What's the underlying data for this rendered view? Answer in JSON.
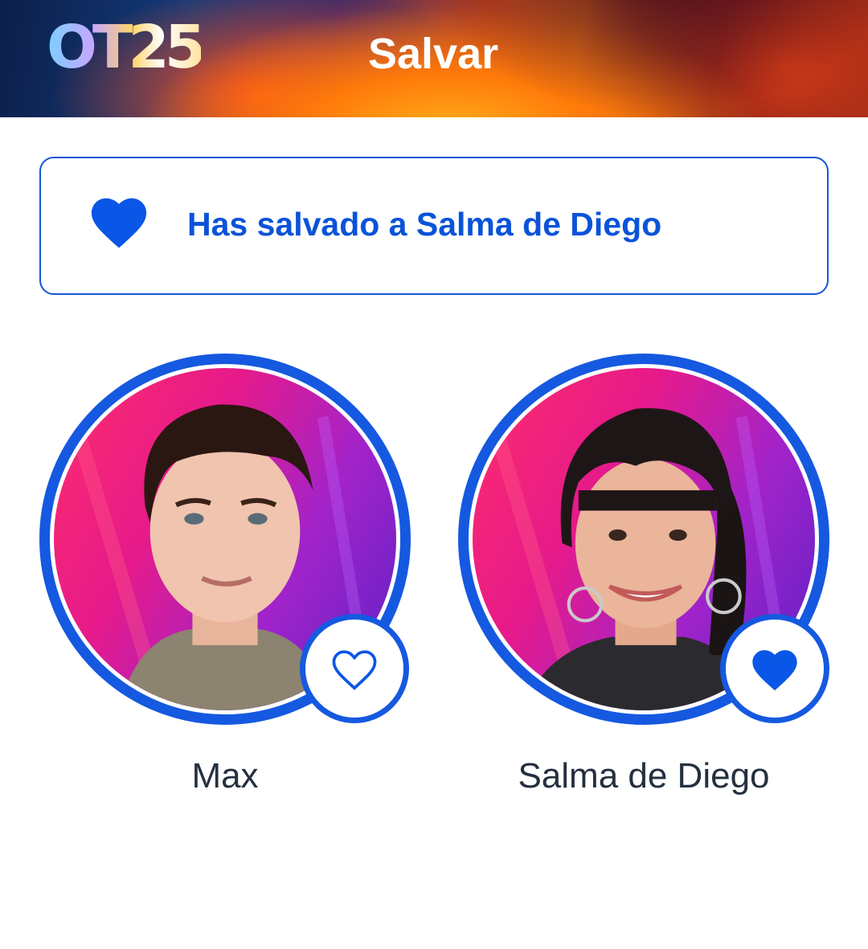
{
  "header": {
    "logo_text": "OT25",
    "title": "Salvar"
  },
  "banner": {
    "icon": "heart-filled-icon",
    "message": "Has salvado a Salma de Diego"
  },
  "candidates": [
    {
      "name": "Max",
      "saved": false,
      "heart_icon": "heart-outline-icon"
    },
    {
      "name": "Salma de Diego",
      "saved": true,
      "heart_icon": "heart-filled-icon"
    }
  ],
  "colors": {
    "accent": "#1559e0",
    "accent_text": "#0a53d9",
    "name_text": "#25303f"
  }
}
